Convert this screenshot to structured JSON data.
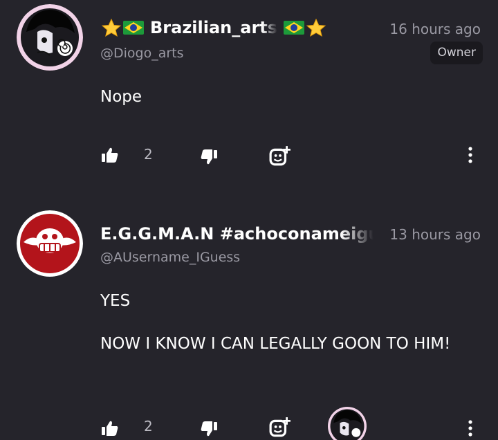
{
  "comments": [
    {
      "name": "Brazilian_arts",
      "name_prefix_emoji": [
        "star",
        "brazil-flag"
      ],
      "name_suffix_emoji": [
        "brazil-flag",
        "star"
      ],
      "handle": "@Diogo_arts",
      "time": "16 hours ago",
      "badge": "Owner",
      "lines": [
        "Nope"
      ],
      "likes": "2",
      "avatar_icon": "dark-haired-character-avatar-icon"
    },
    {
      "name": "E.G.G.M.A.N #achoconameiguei",
      "handle": "@AUsername_IGuess",
      "time": "13 hours ago",
      "lines": [
        "YES",
        "NOW I KNOW I CAN LEGALLY GOON TO HIM!"
      ],
      "likes": "2",
      "avatar_icon": "eggman-logo-icon",
      "reaction_avatar_icon": "dark-haired-character-avatar-icon"
    }
  ],
  "colors": {
    "background": "#25242b",
    "text_primary": "#ffffff",
    "text_secondary": "#9a99a3",
    "badge_bg": "#1a191e",
    "eggman_red": "#b3141b"
  }
}
